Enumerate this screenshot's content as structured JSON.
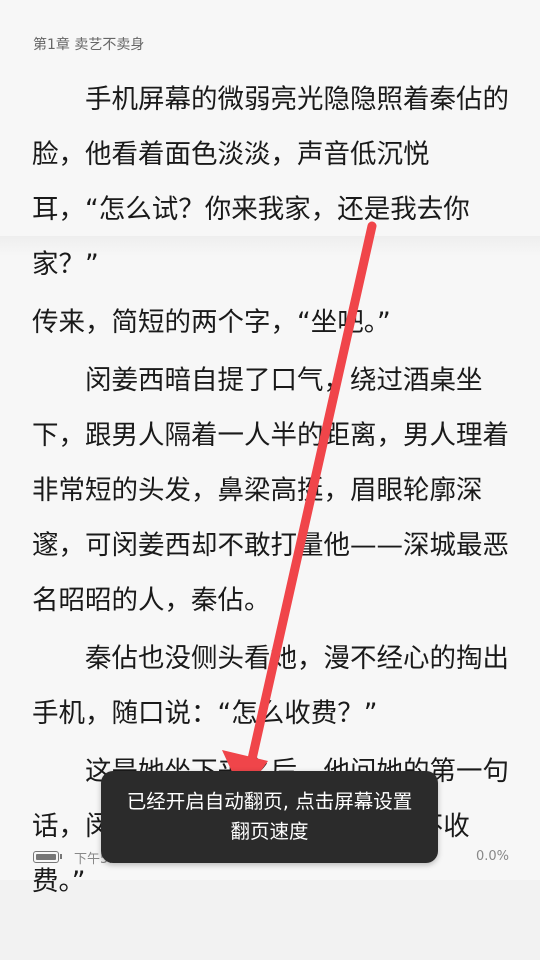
{
  "header": {
    "chapter_title": "第1章 卖艺不卖身"
  },
  "content": {
    "paragraphs": [
      "手机屏幕的微弱亮光隐隐照着秦佔的脸，他看着面色淡淡，声音低沉悦耳，“怎么试？你来我家，还是我去你家？”",
      "传来，简短的两个字，“坐吧。”",
      "闵姜西暗自提了口气，绕过酒桌坐下，跟男人隔着一人半的距离，男人理着非常短的头发，鼻梁高挺，眉眼轮廓深邃，可闵姜西却不敢打量他——深城最恶名昭昭的人，秦佔。",
      "秦佔也没侧头看她，漫不经心的掏出手机，随口说：“怎么收费？”",
      "这是她坐下来之后，他问她的第一句话，闵姜西马上回道：“试用期间不收费。”"
    ]
  },
  "status_bar": {
    "time": "下午5:07",
    "progress": "0.0%"
  },
  "toast": {
    "message": "已经开启自动翻页, 点击屏幕设置翻页速度"
  },
  "colors": {
    "background": "#f7f7f7",
    "text": "#1a1a1a",
    "toast_bg": "#2b2b2b",
    "arrow": "#f0454a"
  }
}
